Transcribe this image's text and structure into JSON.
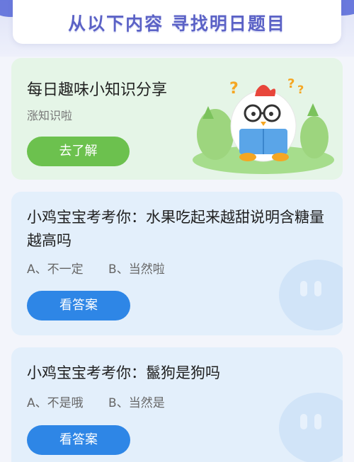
{
  "header": {
    "title": "从以下内容 寻找明日题目"
  },
  "promo": {
    "title": "每日趣味小知识分享",
    "subtitle": "涨知识啦",
    "button_label": "去了解",
    "illustration": "chick-reading-icon"
  },
  "questions": [
    {
      "title": "小鸡宝宝考考你：水果吃起来越甜说明含糖量越高吗",
      "option_a": "A、不一定",
      "option_b": "B、当然啦",
      "button_label": "看答案"
    },
    {
      "title": "小鸡宝宝考考你：鬣狗是狗吗",
      "option_a": "A、不是哦",
      "option_b": "B、当然是",
      "button_label": "看答案"
    }
  ],
  "colors": {
    "header_text": "#5b62c6",
    "promo_bg": "#e5f5e7",
    "promo_button": "#6cc14e",
    "question_bg": "#e3effb",
    "answer_button": "#2e86e6"
  }
}
